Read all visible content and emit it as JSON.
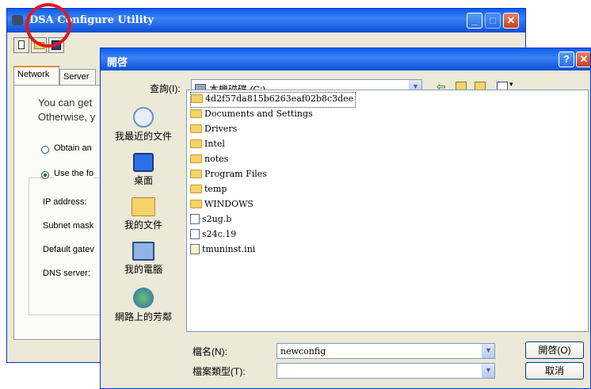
{
  "back_window": {
    "title": "DSA Configure Utility",
    "tabs": [
      "Network",
      "Server"
    ],
    "intro_line1": "You can get",
    "intro_line2": "Otherwise, y",
    "radio_obtain": "Obtain an",
    "radio_use": "Use the fo",
    "fields": [
      "IP address:",
      "Subnet mask",
      "Default gatev",
      "DNS server:"
    ]
  },
  "dialog": {
    "title": "開啓",
    "help_label": "?",
    "look_in_label": "查詢(I):",
    "look_in_value": "本機磁碟 (C:)",
    "places": [
      "我最近的文件",
      "桌面",
      "我的文件",
      "我的電腦",
      "網路上的芳鄰"
    ],
    "files": [
      {
        "name": "4d2f57da815b6263eaf02b8c3dee",
        "type": "folder"
      },
      {
        "name": "Documents and Settings",
        "type": "folder"
      },
      {
        "name": "Drivers",
        "type": "folder"
      },
      {
        "name": "Intel",
        "type": "folder"
      },
      {
        "name": "notes",
        "type": "folder"
      },
      {
        "name": "Program Files",
        "type": "folder"
      },
      {
        "name": "temp",
        "type": "folder"
      },
      {
        "name": "WINDOWS",
        "type": "folder"
      },
      {
        "name": "s2ug.b",
        "type": "file"
      },
      {
        "name": "s24c.19",
        "type": "file"
      },
      {
        "name": "tmuninst.ini",
        "type": "ini"
      }
    ],
    "filename_label": "檔名(N):",
    "filename_value": "newconfig",
    "filetype_label": "檔案類型(T):",
    "filetype_value": "",
    "open_button": "開啓(O)",
    "cancel_button": "取消"
  },
  "colors": {
    "title_bar": "#0a5fe8",
    "highlight_circle": "#e0191c",
    "dialog_bg": "#ece9d8"
  }
}
